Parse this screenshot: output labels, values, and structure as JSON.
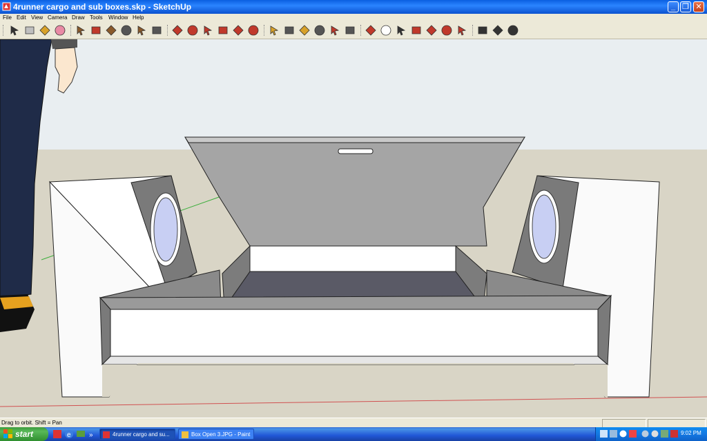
{
  "window": {
    "title": "4runner cargo and sub boxes.skp - SketchUp",
    "controls": [
      "_",
      "❐",
      "✕"
    ]
  },
  "menu": [
    "File",
    "Edit",
    "View",
    "Camera",
    "Draw",
    "Tools",
    "Window",
    "Help"
  ],
  "toolbar": {
    "tools": [
      {
        "icon": "select-arrow-icon",
        "color": "#333333"
      },
      {
        "icon": "make-component-icon",
        "color": "#bfbfbf"
      },
      {
        "icon": "paint-bucket-icon",
        "color": "#d7a12a"
      },
      {
        "icon": "eraser-icon",
        "color": "#e98aa5"
      },
      {
        "icon": "rectangle-icon",
        "color": "#8a5a2b"
      },
      {
        "icon": "line-pencil-icon",
        "color": "#c0392b"
      },
      {
        "icon": "circle-icon",
        "color": "#8a5a2b"
      },
      {
        "icon": "arc-icon",
        "color": "#555555"
      },
      {
        "icon": "polygon-icon",
        "color": "#8a5a2b"
      },
      {
        "icon": "freehand-icon",
        "color": "#555555"
      },
      {
        "icon": "move-icon",
        "color": "#c0392b"
      },
      {
        "icon": "push-pull-icon",
        "color": "#c0392b"
      },
      {
        "icon": "rotate-icon",
        "color": "#c0392b"
      },
      {
        "icon": "follow-me-icon",
        "color": "#c0392b"
      },
      {
        "icon": "scale-icon",
        "color": "#c0392b"
      },
      {
        "icon": "offset-icon",
        "color": "#c0392b"
      },
      {
        "icon": "tape-measure-icon",
        "color": "#d7a12a"
      },
      {
        "icon": "dimension-icon",
        "color": "#555555"
      },
      {
        "icon": "protractor-icon",
        "color": "#d7a12a"
      },
      {
        "icon": "text-icon",
        "color": "#555555"
      },
      {
        "icon": "axes-icon",
        "color": "#c0392b"
      },
      {
        "icon": "3d-text-icon",
        "color": "#555555"
      },
      {
        "icon": "orbit-icon",
        "color": "#c0392b"
      },
      {
        "icon": "pan-hand-icon",
        "color": "#ffffff"
      },
      {
        "icon": "zoom-icon",
        "color": "#333333"
      },
      {
        "icon": "zoom-window-icon",
        "color": "#c0392b"
      },
      {
        "icon": "zoom-extents-icon",
        "color": "#c0392b"
      },
      {
        "icon": "previous-view-icon",
        "color": "#c0392b"
      },
      {
        "icon": "position-camera-icon",
        "color": "#c0392b"
      },
      {
        "icon": "look-around-icon",
        "color": "#333333"
      },
      {
        "icon": "walk-icon",
        "color": "#333333"
      },
      {
        "icon": "section-plane-icon",
        "color": "#333333"
      }
    ]
  },
  "status": {
    "text": "Drag to orbit.  Shift = Pan"
  },
  "taskbar": {
    "start_label": "start",
    "tasks": [
      {
        "label": "4runner cargo and su...",
        "active": true
      },
      {
        "label": "Box Open 3.JPG - Paint",
        "active": false
      }
    ],
    "clock": "9:02 PM"
  },
  "colors": {
    "sky": "#e8eef2",
    "ground": "#d9d5c6",
    "accent": "#245edb"
  }
}
